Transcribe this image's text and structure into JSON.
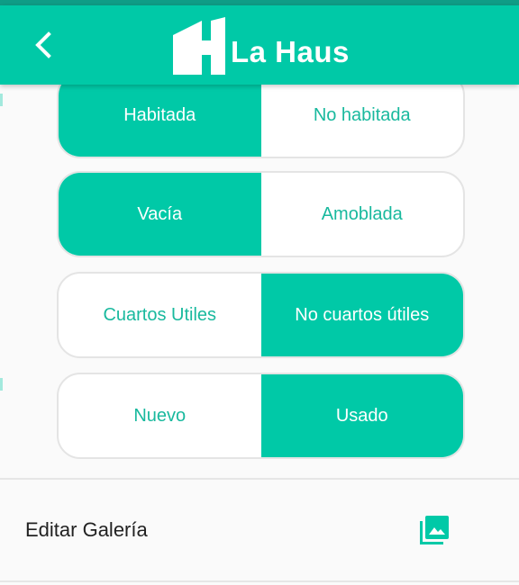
{
  "app": {
    "title": "La Haus"
  },
  "toggles": [
    {
      "left": "Habitada",
      "right": "No habitada",
      "selected": "left"
    },
    {
      "left": "Vacía",
      "right": "Amoblada",
      "selected": "left"
    },
    {
      "left": "Cuartos Utiles",
      "right": "No cuartos útiles",
      "selected": "right"
    },
    {
      "left": "Nuevo",
      "right": "Usado",
      "selected": "right"
    }
  ],
  "gallery": {
    "label": "Editar Galería",
    "icon": "photo-library-icon"
  },
  "colors": {
    "primary": "#00c9a7",
    "primary_dark": "#0f9c86",
    "text": "#222222"
  }
}
